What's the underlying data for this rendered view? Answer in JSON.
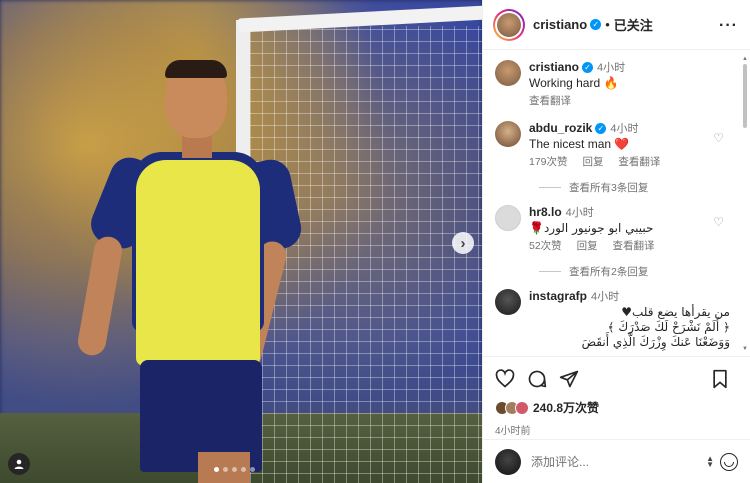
{
  "post": {
    "carousel": {
      "current_index": 1,
      "total_images": 5
    }
  },
  "header": {
    "username": "cristiano",
    "separator": "•",
    "follow_status": "已关注",
    "more": "···"
  },
  "caption": {
    "username": "cristiano",
    "time": "4小时",
    "text": "Working hard 🔥",
    "translate": "查看翻译"
  },
  "comments": [
    {
      "username": "abdu_rozik",
      "verified": true,
      "time": "4小时",
      "text": "The nicest man ❤️",
      "likes": "179次赞",
      "reply": "回复",
      "translate": "查看翻译",
      "view_replies": "查看所有3条回复"
    },
    {
      "username": "hr8.lo",
      "verified": false,
      "time": "4小时",
      "text": "حبيبي ابو جونيور الورد🌹",
      "likes": "52次赞",
      "reply": "回复",
      "translate": "查看翻译",
      "view_replies": "查看所有2条回复"
    },
    {
      "username": "instagrafp",
      "verified": false,
      "time": "4小时",
      "text_lines": [
        "من يقرأها يضع قلب♥",
        "﴿ أَلَمْ نَشْرَحْ لَكَ صَدْرَكَ ﴾",
        "وَوَضَعْنَا عَنكَ وِزْرَكَ الَّذِي أَنقَضَ"
      ]
    }
  ],
  "actions": {
    "likes_count": "240.8万次赞",
    "posted_ago": "4小时前"
  },
  "add_comment": {
    "placeholder": "添加评论..."
  },
  "colors": {
    "verified_blue": "#0095f6",
    "text_primary": "#262626",
    "text_secondary": "#737373",
    "jersey_yellow": "#e9e64a",
    "jersey_blue": "#1e2d7a"
  },
  "icons": [
    "verified-icon",
    "heart-icon",
    "comment-icon",
    "share-icon",
    "save-icon",
    "emoji-icon",
    "next-arrow-icon",
    "user-tag-icon",
    "fire-emoji",
    "red-heart-emoji"
  ]
}
